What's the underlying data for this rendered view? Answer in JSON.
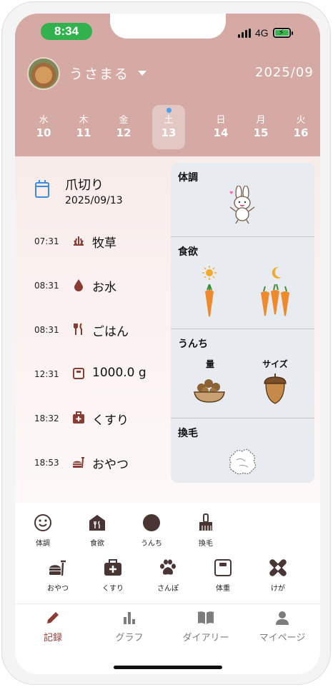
{
  "status_bar": {
    "time": "8:34",
    "network": "4G"
  },
  "header": {
    "pet_name": "うさまる",
    "month": "2025/09"
  },
  "week": [
    {
      "weekday": "水",
      "day": "10",
      "selected": false
    },
    {
      "weekday": "木",
      "day": "11",
      "selected": false
    },
    {
      "weekday": "金",
      "day": "12",
      "selected": false
    },
    {
      "weekday": "土",
      "day": "13",
      "selected": true
    },
    {
      "weekday": "日",
      "day": "14",
      "selected": false
    },
    {
      "weekday": "月",
      "day": "15",
      "selected": false
    },
    {
      "weekday": "火",
      "day": "16",
      "selected": false
    }
  ],
  "event": {
    "title": "爪切り",
    "date": "2025/09/13"
  },
  "logs": [
    {
      "time": "07:31",
      "icon": "hay-icon",
      "label": "牧草"
    },
    {
      "time": "08:31",
      "icon": "water-drop-icon",
      "label": "お水"
    },
    {
      "time": "08:31",
      "icon": "fork-knife-icon",
      "label": "ごはん"
    },
    {
      "time": "12:31",
      "icon": "scale-icon",
      "label": "1000.0 g"
    },
    {
      "time": "18:32",
      "icon": "medicine-box-icon",
      "label": "くすり"
    },
    {
      "time": "18:53",
      "icon": "snack-icon",
      "label": "おやつ"
    }
  ],
  "panel": {
    "condition": {
      "title": "体調",
      "icon": "happy-rabbit-icon"
    },
    "appetite": {
      "title": "食欲",
      "morning_icon": "sun-icon",
      "night_icon": "moon-icon"
    },
    "poop": {
      "title": "うんち",
      "amount_label": "量",
      "size_label": "サイズ"
    },
    "shedding": {
      "title": "換毛",
      "icon": "fur-ball-icon"
    }
  },
  "quick_row1": [
    {
      "icon": "smile-icon",
      "label": "体調"
    },
    {
      "icon": "food-house-icon",
      "label": "食欲"
    },
    {
      "icon": "circle-icon",
      "label": "うんち"
    },
    {
      "icon": "brush-icon",
      "label": "換毛"
    }
  ],
  "quick_row2": [
    {
      "icon": "burger-icon",
      "label": "おやつ"
    },
    {
      "icon": "medical-kit-icon",
      "label": "くすり"
    },
    {
      "icon": "paw-icon",
      "label": "さんぽ"
    },
    {
      "icon": "scale-icon",
      "label": "体重"
    },
    {
      "icon": "bandage-icon",
      "label": "けが"
    }
  ],
  "nav": [
    {
      "icon": "pencil-icon",
      "label": "記録",
      "active": true
    },
    {
      "icon": "bar-chart-icon",
      "label": "グラフ",
      "active": false
    },
    {
      "icon": "book-icon",
      "label": "ダイアリー",
      "active": false
    },
    {
      "icon": "person-icon",
      "label": "マイページ",
      "active": false
    }
  ],
  "colors": {
    "header": "#d5a9a4",
    "accent": "#8a3b33",
    "panel": "#e8ebef",
    "selected_dot": "#4aa3ee",
    "time_pill": "#31b24e"
  }
}
